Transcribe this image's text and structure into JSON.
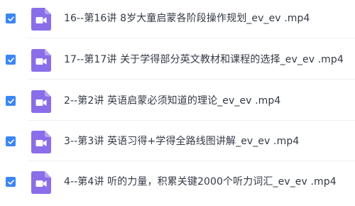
{
  "files": [
    {
      "name": "16--第16讲 8岁大童启蒙各阶段操作规划_ev_ev .mp4",
      "checked": true
    },
    {
      "name": "17--第17讲 关于学得部分英文教材和课程的选择_ev_ev .mp4",
      "checked": true
    },
    {
      "name": "2--第2讲 英语启蒙必须知道的理论_ev_ev .mp4",
      "checked": true
    },
    {
      "name": "3--第3讲 英语习得+学得全路线图讲解_ev_ev .mp4",
      "checked": true
    },
    {
      "name": "4--第4讲 听的力量，积累关键2000个听力词汇_ev_ev .mp4",
      "checked": true
    }
  ],
  "colors": {
    "checkbox": "#3a86f5",
    "file_icon": "#8a6ee9"
  },
  "icons": {
    "checkbox": "check-icon",
    "file": "video-file-icon"
  }
}
